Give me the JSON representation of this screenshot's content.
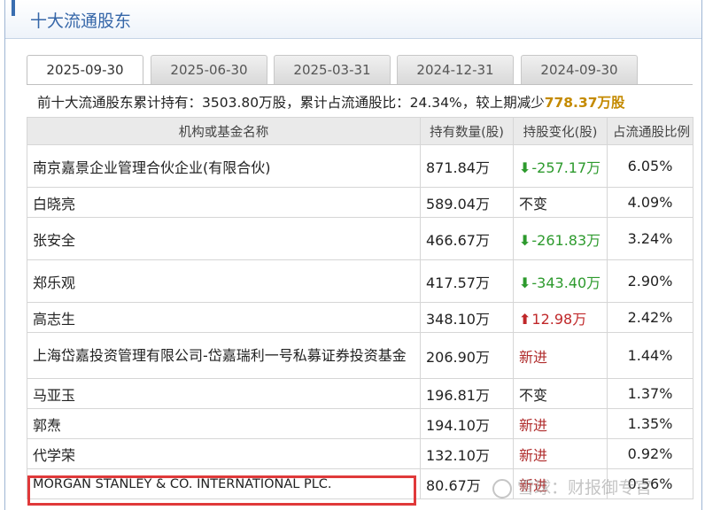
{
  "section": {
    "title": "十大流通股东"
  },
  "tabs": [
    "2025-09-30",
    "2025-06-30",
    "2025-03-31",
    "2024-12-31",
    "2024-09-30"
  ],
  "active_tab": 0,
  "summary": {
    "prefix": "前十大流通股东累计持有：3503.80万股，累计占流通股比：24.34%，较上期减少",
    "highlight": "778.37万股"
  },
  "table": {
    "headers": [
      "机构或基金名称",
      "持有数量(股)",
      "持股变化(股)",
      "占流通股比例"
    ],
    "rows": [
      {
        "name": "南京嘉景企业管理合伙企业(有限合伙)",
        "qty": "871.84万",
        "change": "-257.17万",
        "change_type": "down",
        "pct": "6.05%"
      },
      {
        "name": "白晓亮",
        "qty": "589.04万",
        "change": "不变",
        "change_type": "same",
        "pct": "4.09%"
      },
      {
        "name": "张安全",
        "qty": "466.67万",
        "change": "-261.83万",
        "change_type": "down",
        "pct": "3.24%"
      },
      {
        "name": "郑乐观",
        "qty": "417.57万",
        "change": "-343.40万",
        "change_type": "down",
        "pct": "2.90%"
      },
      {
        "name": "高志生",
        "qty": "348.10万",
        "change": "12.98万",
        "change_type": "up",
        "pct": "2.42%"
      },
      {
        "name": "上海岱嘉投资管理有限公司-岱嘉瑞利一号私募证券投资基金",
        "qty": "206.90万",
        "change": "新进",
        "change_type": "new",
        "pct": "1.44%"
      },
      {
        "name": "马亚玉",
        "qty": "196.81万",
        "change": "不变",
        "change_type": "same",
        "pct": "1.37%"
      },
      {
        "name": "郭焘",
        "qty": "194.10万",
        "change": "新进",
        "change_type": "new",
        "pct": "1.35%"
      },
      {
        "name": "代学荣",
        "qty": "132.10万",
        "change": "新进",
        "change_type": "new",
        "pct": "0.92%"
      },
      {
        "name": "MORGAN STANLEY & CO. INTERNATIONAL PLC.",
        "qty": "80.67万",
        "change": "新进",
        "change_type": "new",
        "pct": "0.56%"
      }
    ]
  },
  "watermark": {
    "text": "雪球：财报御专官"
  },
  "colors": {
    "accent": "#3566a8",
    "down": "#2d9a2d",
    "up": "#c0282a",
    "highlight": "#c48a00",
    "box": "#e0393a"
  }
}
